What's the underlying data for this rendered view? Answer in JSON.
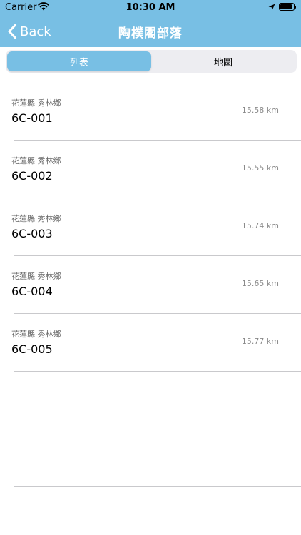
{
  "status_bar": {
    "carrier": "Carrier",
    "time": "10:30 AM",
    "battery_level": 0.9
  },
  "nav": {
    "back_label": "Back",
    "title": "陶樸閣部落"
  },
  "segment": {
    "tabs": [
      {
        "label": "列表",
        "selected": true
      },
      {
        "label": "地圖",
        "selected": false
      }
    ]
  },
  "list": {
    "items": [
      {
        "region": "花蓮縣  秀林鄉",
        "code": "6C-001",
        "distance": "15.58 km"
      },
      {
        "region": "花蓮縣  秀林鄉",
        "code": "6C-002",
        "distance": "15.55 km"
      },
      {
        "region": "花蓮縣  秀林鄉",
        "code": "6C-003",
        "distance": "15.74 km"
      },
      {
        "region": "花蓮縣  秀林鄉",
        "code": "6C-004",
        "distance": "15.65 km"
      },
      {
        "region": "花蓮縣  秀林鄉",
        "code": "6C-005",
        "distance": "15.77 km"
      }
    ]
  },
  "colors": {
    "accent": "#78bfe4",
    "segment_bg": "#ededf1",
    "separator": "#c9c9cc"
  }
}
